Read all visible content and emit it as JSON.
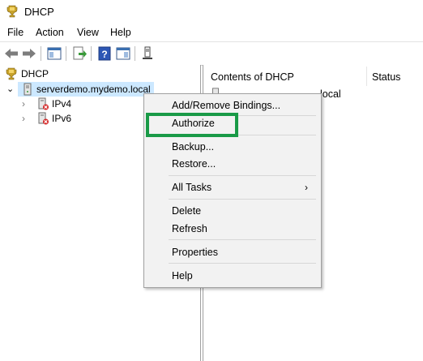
{
  "window": {
    "title": "DHCP"
  },
  "menubar": {
    "items": [
      "File",
      "Action",
      "View",
      "Help"
    ]
  },
  "tree": {
    "root": "DHCP",
    "server": "serverdemo.mydemo.local",
    "children": [
      "IPv4",
      "IPv6"
    ]
  },
  "right_pane": {
    "columns": [
      "Contents of DHCP",
      "Status"
    ],
    "row_partial": "local"
  },
  "context_menu": {
    "items": [
      "Add/Remove Bindings...",
      "Authorize",
      "Backup...",
      "Restore...",
      "All Tasks",
      "Delete",
      "Refresh",
      "Properties",
      "Help"
    ],
    "submenu_arrow": "›"
  },
  "colors": {
    "highlight": "#1a9a47",
    "selection": "#cce8ff"
  }
}
